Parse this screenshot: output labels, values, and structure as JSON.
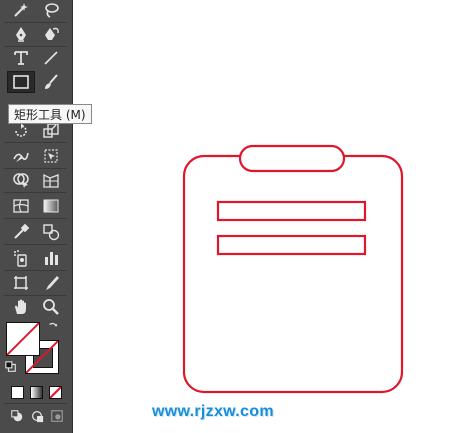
{
  "tooltip": {
    "text": "矩形工具 (M)"
  },
  "watermark": {
    "text": "www.rjzxw.com"
  },
  "colors": {
    "panel": "#4b4b4b",
    "icon": "#e4e4e4",
    "shape_stroke": "#e0162b",
    "watermark": "#1a8fd8",
    "none_slash": "#e0162b"
  },
  "tools": [
    "magic-wand-icon",
    "lasso-icon",
    "pen-icon",
    "curvature-pen-icon",
    "type-icon",
    "line-segment-icon",
    "rectangle-icon",
    "paintbrush-icon",
    "rotate-icon",
    "scale-icon",
    "warp-icon",
    "free-transform-icon",
    "shape-builder-icon",
    "perspective-grid-icon",
    "mesh-icon",
    "gradient-icon",
    "eyedropper-icon",
    "blend-icon",
    "symbol-sprayer-icon",
    "column-graph-icon",
    "artboard-icon",
    "slice-icon",
    "hand-icon",
    "zoom-icon"
  ]
}
